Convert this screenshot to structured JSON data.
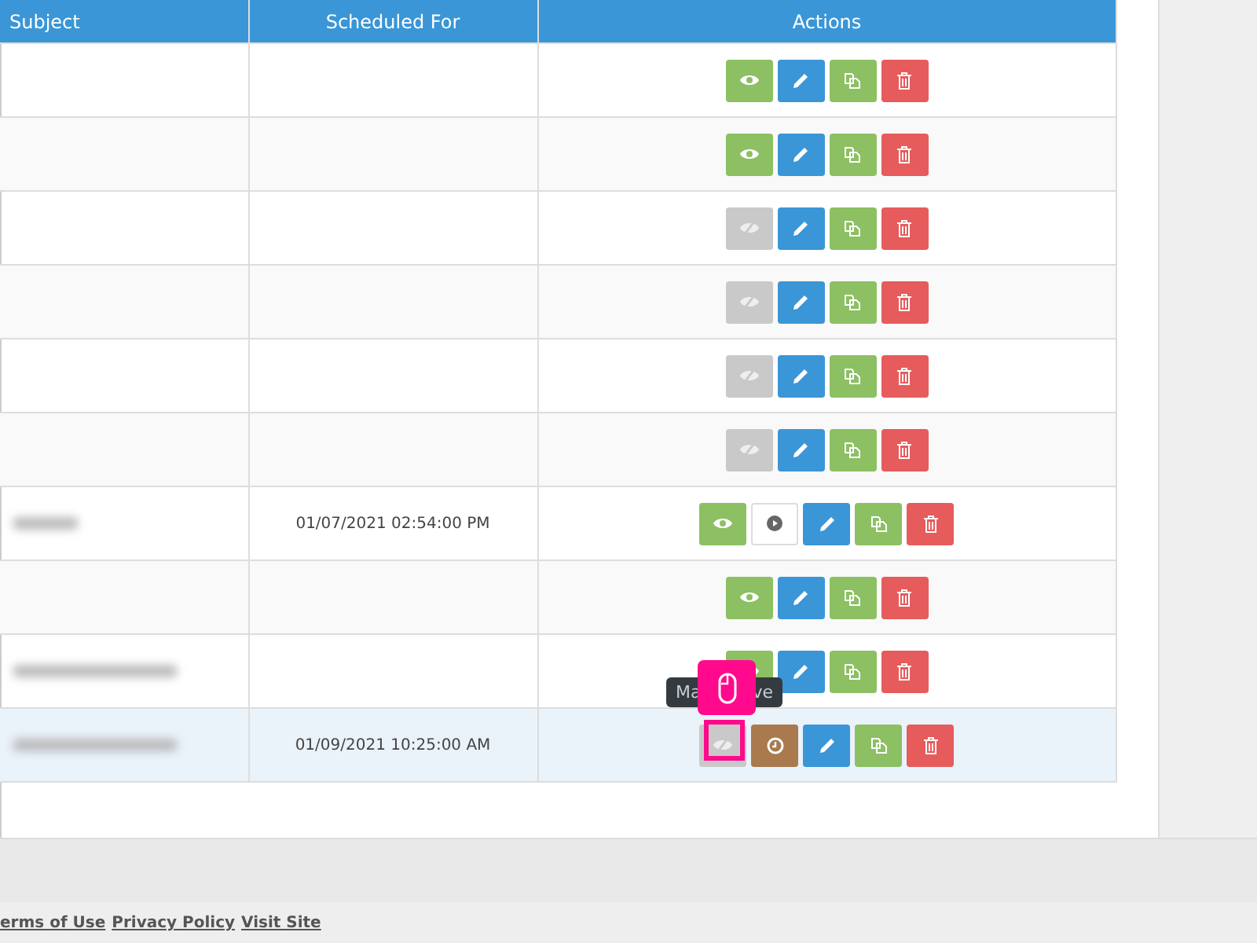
{
  "table": {
    "columns": [
      "Subject",
      "Scheduled For",
      "Actions"
    ],
    "rows": [
      {
        "selected": false,
        "actions": [
          {
            "kind": "view"
          },
          {
            "kind": "edit"
          },
          {
            "kind": "copy"
          },
          {
            "kind": "delete"
          }
        ]
      },
      {
        "selected": false,
        "actions": [
          {
            "kind": "view"
          },
          {
            "kind": "edit"
          },
          {
            "kind": "copy"
          },
          {
            "kind": "delete"
          }
        ]
      },
      {
        "selected": false,
        "actions": [
          {
            "kind": "hidden"
          },
          {
            "kind": "edit"
          },
          {
            "kind": "copy"
          },
          {
            "kind": "delete"
          }
        ]
      },
      {
        "selected": false,
        "actions": [
          {
            "kind": "hidden"
          },
          {
            "kind": "edit"
          },
          {
            "kind": "copy"
          },
          {
            "kind": "delete"
          }
        ]
      },
      {
        "selected": false,
        "actions": [
          {
            "kind": "hidden"
          },
          {
            "kind": "edit"
          },
          {
            "kind": "copy"
          },
          {
            "kind": "delete"
          }
        ]
      },
      {
        "selected": false,
        "actions": [
          {
            "kind": "hidden"
          },
          {
            "kind": "edit"
          },
          {
            "kind": "copy"
          },
          {
            "kind": "delete"
          }
        ]
      },
      {
        "selected": false,
        "blurred_subject": {
          "kind": "short"
        },
        "scheduled": "01/07/2021 02:54:00 PM",
        "actions": [
          {
            "kind": "view"
          },
          {
            "kind": "play"
          },
          {
            "kind": "edit"
          },
          {
            "kind": "copy"
          },
          {
            "kind": "delete"
          }
        ]
      },
      {
        "selected": false,
        "actions": [
          {
            "kind": "view"
          },
          {
            "kind": "edit"
          },
          {
            "kind": "copy"
          },
          {
            "kind": "delete"
          }
        ]
      },
      {
        "selected": false,
        "blurred_subject": {
          "kind": "long"
        },
        "actions": [
          {
            "kind": "view"
          },
          {
            "kind": "edit"
          },
          {
            "kind": "copy"
          },
          {
            "kind": "delete"
          }
        ]
      },
      {
        "selected": true,
        "blurred_subject": {
          "kind": "long"
        },
        "scheduled": "01/09/2021 10:25:00 AM",
        "actions": [
          {
            "kind": "hidden"
          },
          {
            "kind": "schedule"
          },
          {
            "kind": "edit"
          },
          {
            "kind": "copy"
          },
          {
            "kind": "delete"
          }
        ]
      }
    ]
  },
  "tooltip": {
    "text_start": "Ma",
    "text_end": "ve"
  },
  "footer": {
    "links": [
      "erms of Use",
      "Privacy Policy",
      "Visit Site"
    ]
  }
}
